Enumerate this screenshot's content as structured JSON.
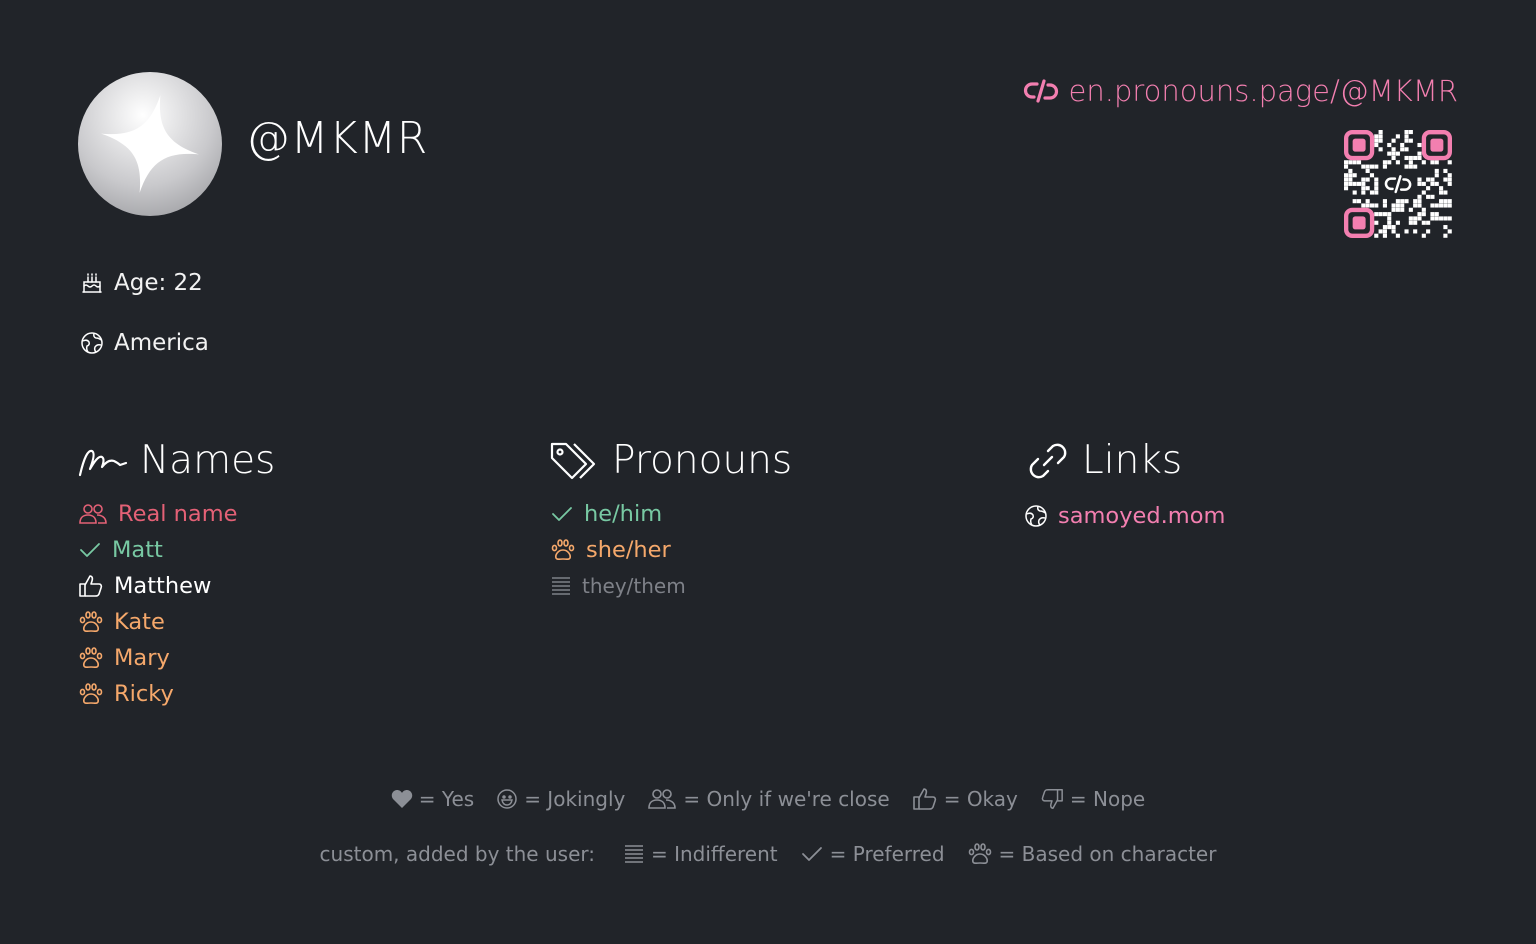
{
  "profile": {
    "username": "@MKMR",
    "link_text": "en.pronouns.page/@MKMR"
  },
  "meta": {
    "age": "Age: 22",
    "location": "America"
  },
  "sections": {
    "names": {
      "title": "Names",
      "items": [
        {
          "label": "Real name",
          "icon": "users-icon",
          "color": "#e46176"
        },
        {
          "label": "Matt",
          "icon": "check-icon",
          "color": "#78c9a3"
        },
        {
          "label": "Matthew",
          "icon": "thumbs-up-icon",
          "color": "#ffffff"
        },
        {
          "label": "Kate",
          "icon": "paw-icon",
          "color": "#f5a86b"
        },
        {
          "label": "Mary",
          "icon": "paw-icon",
          "color": "#f5a86b"
        },
        {
          "label": "Ricky",
          "icon": "paw-icon",
          "color": "#f5a86b"
        }
      ]
    },
    "pronouns": {
      "title": "Pronouns",
      "items": [
        {
          "label": "he/him",
          "icon": "check-icon",
          "color": "#78c9a3"
        },
        {
          "label": "she/her",
          "icon": "paw-icon",
          "color": "#f5a86b"
        },
        {
          "label": "they/them",
          "icon": "lines-icon",
          "color": "#7e8188"
        }
      ]
    },
    "links": {
      "title": "Links",
      "items": [
        {
          "label": "samoyed.mom",
          "icon": "globe-icon",
          "color": "#f37fb0"
        }
      ]
    }
  },
  "legend": {
    "row1": [
      {
        "icon": "heart-icon",
        "text": "= Yes"
      },
      {
        "icon": "smile-icon",
        "text": "= Jokingly"
      },
      {
        "icon": "users-icon",
        "text": "= Only if we're close"
      },
      {
        "icon": "thumbs-up-icon",
        "text": "= Okay"
      },
      {
        "icon": "thumbs-down-icon",
        "text": "= Nope"
      }
    ],
    "custom_label": "custom, added by the user:",
    "row2": [
      {
        "icon": "lines-icon",
        "text": "= Indifferent"
      },
      {
        "icon": "check-icon",
        "text": "= Preferred"
      },
      {
        "icon": "paw-icon",
        "text": "= Based on character"
      }
    ]
  },
  "colors": {
    "background": "#212429",
    "accent_pink": "#f37fb0",
    "red": "#e46176",
    "green": "#78c9a3",
    "orange": "#f5a86b",
    "muted": "#8c8f96"
  }
}
